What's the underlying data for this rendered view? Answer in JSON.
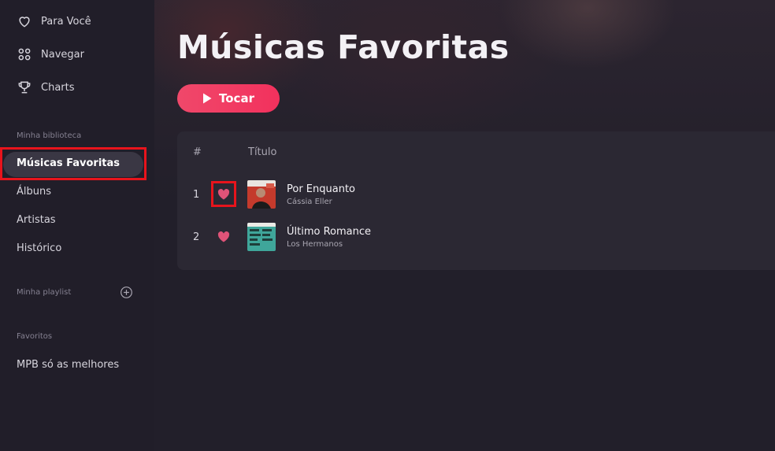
{
  "nav": {
    "items": [
      {
        "label": "Para Você",
        "icon": "heart-outline-icon"
      },
      {
        "label": "Navegar",
        "icon": "grid-icon"
      },
      {
        "label": "Charts",
        "icon": "trophy-icon"
      }
    ]
  },
  "library": {
    "section_label": "Minha biblioteca",
    "active_label": "Músicas Favoritas",
    "items": [
      "Álbuns",
      "Artistas",
      "Histórico"
    ]
  },
  "playlists": {
    "section_label": "Minha playlist",
    "add_icon": "plus-circle-icon"
  },
  "favorites": {
    "section_label": "Favoritos",
    "items": [
      "MPB só as melhores"
    ]
  },
  "main": {
    "title": "Músicas Favoritas",
    "play_label": "Tocar",
    "columns": {
      "number": "#",
      "title": "Título"
    },
    "tracks": [
      {
        "number": "1",
        "title": "Por Enquanto",
        "artist": "Cássia Eller",
        "liked": true
      },
      {
        "number": "2",
        "title": "Último Romance",
        "artist": "Los Hermanos",
        "liked": true
      }
    ]
  },
  "colors": {
    "accent": "#f23a62",
    "highlight_box": "#e8141c",
    "heart": "#e05378"
  }
}
